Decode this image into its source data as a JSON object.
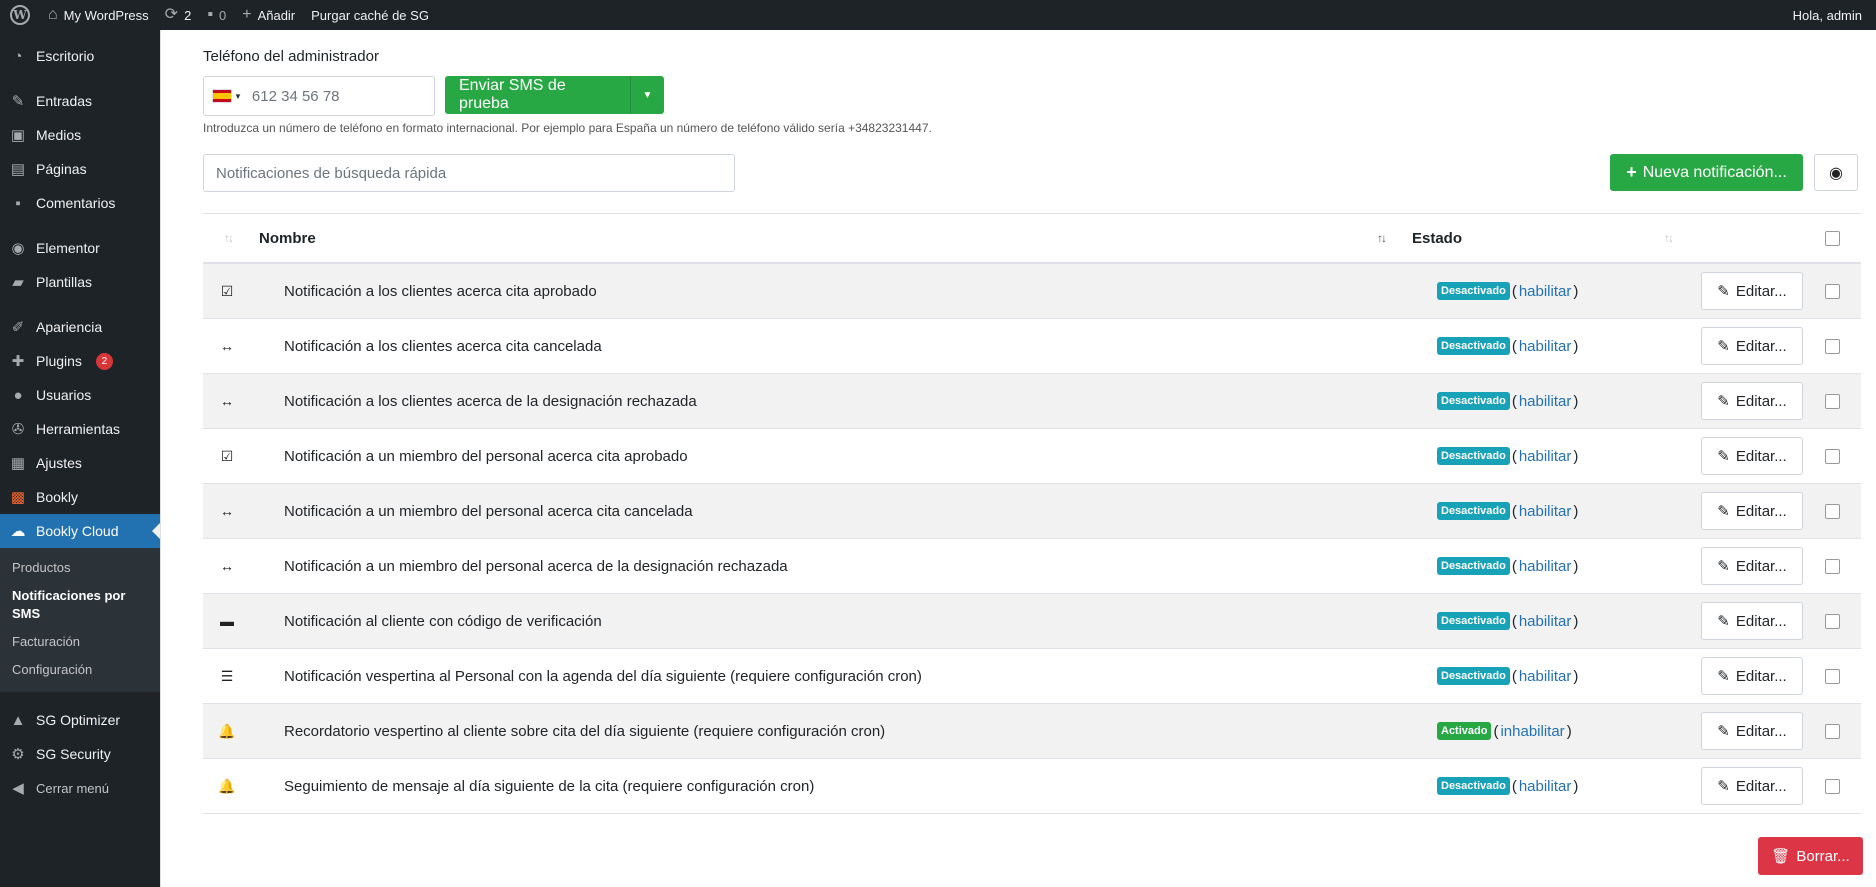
{
  "adminbar": {
    "site_name": "My WordPress",
    "updates_count": "2",
    "comments_count": "0",
    "add_new": "Añadir",
    "purge_cache": "Purgar caché de SG",
    "greeting": "Hola, admin"
  },
  "sidebar": {
    "items": [
      {
        "label": "Escritorio",
        "icon": "dashboard-icon"
      },
      {
        "label": "Entradas",
        "icon": "pin-icon"
      },
      {
        "label": "Medios",
        "icon": "media-icon"
      },
      {
        "label": "Páginas",
        "icon": "pages-icon"
      },
      {
        "label": "Comentarios",
        "icon": "comment-icon"
      },
      {
        "label": "Elementor",
        "icon": "elementor-icon"
      },
      {
        "label": "Plantillas",
        "icon": "folder-icon"
      },
      {
        "label": "Apariencia",
        "icon": "brush-icon"
      },
      {
        "label": "Plugins",
        "icon": "plugin-icon",
        "badge": "2"
      },
      {
        "label": "Usuarios",
        "icon": "user-icon"
      },
      {
        "label": "Herramientas",
        "icon": "wrench-icon"
      },
      {
        "label": "Ajustes",
        "icon": "settings-icon"
      },
      {
        "label": "Bookly",
        "icon": "bookly-icon"
      },
      {
        "label": "Bookly Cloud",
        "icon": "cloud-icon"
      }
    ],
    "submenu": [
      "Productos",
      "Notificaciones por SMS",
      "Facturación",
      "Configuración"
    ],
    "bottom": [
      {
        "label": "SG Optimizer",
        "icon": "sg-optimizer-icon"
      },
      {
        "label": "SG Security",
        "icon": "sg-security-icon"
      },
      {
        "label": "Cerrar menú",
        "icon": "collapse-icon"
      }
    ]
  },
  "form": {
    "phone_label": "Teléfono del administrador",
    "phone_placeholder": "612 34 56 78",
    "send_test_label": "Enviar SMS de prueba",
    "help_text": "Introduzca un número de teléfono en formato internacional. Por ejemplo para España un número de teléfono válido sería +34823231447.",
    "search_placeholder": "Notificaciones de búsqueda rápida",
    "new_notification_label": "Nueva notificación..."
  },
  "table": {
    "columns": {
      "name": "Nombre",
      "status": "Estado"
    },
    "rows": [
      {
        "icon": "calendar-check-icon",
        "name": "Notificación a los clientes acerca cita aprobado",
        "status": "Desactivado",
        "action": "habilitar"
      },
      {
        "icon": "arrows-h-icon",
        "name": "Notificación a los clientes acerca cita cancelada",
        "status": "Desactivado",
        "action": "habilitar"
      },
      {
        "icon": "arrows-h-icon",
        "name": "Notificación a los clientes acerca de la designación rechazada",
        "status": "Desactivado",
        "action": "habilitar"
      },
      {
        "icon": "calendar-check-icon",
        "name": "Notificación a un miembro del personal acerca cita aprobado",
        "status": "Desactivado",
        "action": "habilitar"
      },
      {
        "icon": "arrows-h-icon",
        "name": "Notificación a un miembro del personal acerca cita cancelada",
        "status": "Desactivado",
        "action": "habilitar"
      },
      {
        "icon": "arrows-h-icon",
        "name": "Notificación a un miembro del personal acerca de la designación rechazada",
        "status": "Desactivado",
        "action": "habilitar"
      },
      {
        "icon": "id-card-icon",
        "name": "Notificación al cliente con código de verificación",
        "status": "Desactivado",
        "action": "habilitar"
      },
      {
        "icon": "list-icon",
        "name": "Notificación vespertina al Personal con la agenda del día siguiente (requiere configuración cron)",
        "status": "Desactivado",
        "action": "habilitar"
      },
      {
        "icon": "bell-icon",
        "name": "Recordatorio vespertino al cliente sobre cita del día siguiente (requiere configuración cron)",
        "status": "Activado",
        "action": "inhabilitar"
      },
      {
        "icon": "bell-icon",
        "name": "Seguimiento de mensaje al día siguiente de la cita (requiere configuración cron)",
        "status": "Desactivado",
        "action": "habilitar"
      }
    ],
    "edit_label": "Editar...",
    "delete_label": "Borrar..."
  },
  "colors": {
    "admin_dark": "#1d2327",
    "wp_blue": "#2271b1",
    "success": "#28a745",
    "info": "#17a2b8",
    "danger": "#dc3545"
  }
}
